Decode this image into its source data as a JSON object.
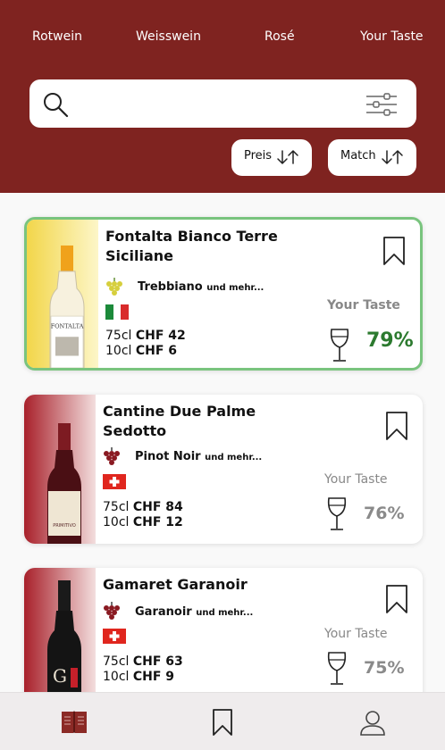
{
  "tabs": [
    {
      "label": "Rotwein"
    },
    {
      "label": "Weisswein"
    },
    {
      "label": "Rosé"
    },
    {
      "label": "Your Taste"
    }
  ],
  "search": {
    "value": "",
    "placeholder": ""
  },
  "sort": {
    "price_label": "Preis",
    "match_label": "Match"
  },
  "wines": [
    {
      "name": "Fontalta Bianco Terre Siciliane",
      "grape": "Trebbiano",
      "grape_more": "und mehr...",
      "grape_color": "#d6cf3d",
      "country_flag": "italy-flag",
      "size_large": "75cl",
      "price_large": "CHF 42",
      "size_small": "10cl",
      "price_small": "CHF 6",
      "taste_label": "Your Taste",
      "match": "79%",
      "bottle_label": "FONTALTA",
      "active": true
    },
    {
      "name": "Cantine Due Palme Sedotto",
      "grape": "Pinot Noir",
      "grape_more": "und mehr...",
      "grape_color": "#8a1a22",
      "country_flag": "switzerland-flag",
      "size_large": "75cl",
      "price_large": "CHF 84",
      "size_small": "10cl",
      "price_small": "CHF 12",
      "taste_label": "Your Taste",
      "match": "76%",
      "bottle_label": "PRIMITIVO",
      "active": false
    },
    {
      "name": "Gamaret Garanoir",
      "grape": "Garanoir",
      "grape_more": "und mehr...",
      "grape_color": "#8a1a22",
      "country_flag": "switzerland-flag",
      "size_large": "75cl",
      "price_large": "CHF 63",
      "size_small": "10cl",
      "price_small": "CHF 9",
      "taste_label": "Your Taste",
      "match": "75%",
      "bottle_label": "G",
      "active": false
    }
  ],
  "bottom_nav": [
    {
      "icon": "book-icon"
    },
    {
      "icon": "bookmark-icon"
    },
    {
      "icon": "user-icon"
    }
  ],
  "colors": {
    "brand": "#7f2320",
    "match_active": "#2c7a2f",
    "active_border": "#79c47e"
  }
}
